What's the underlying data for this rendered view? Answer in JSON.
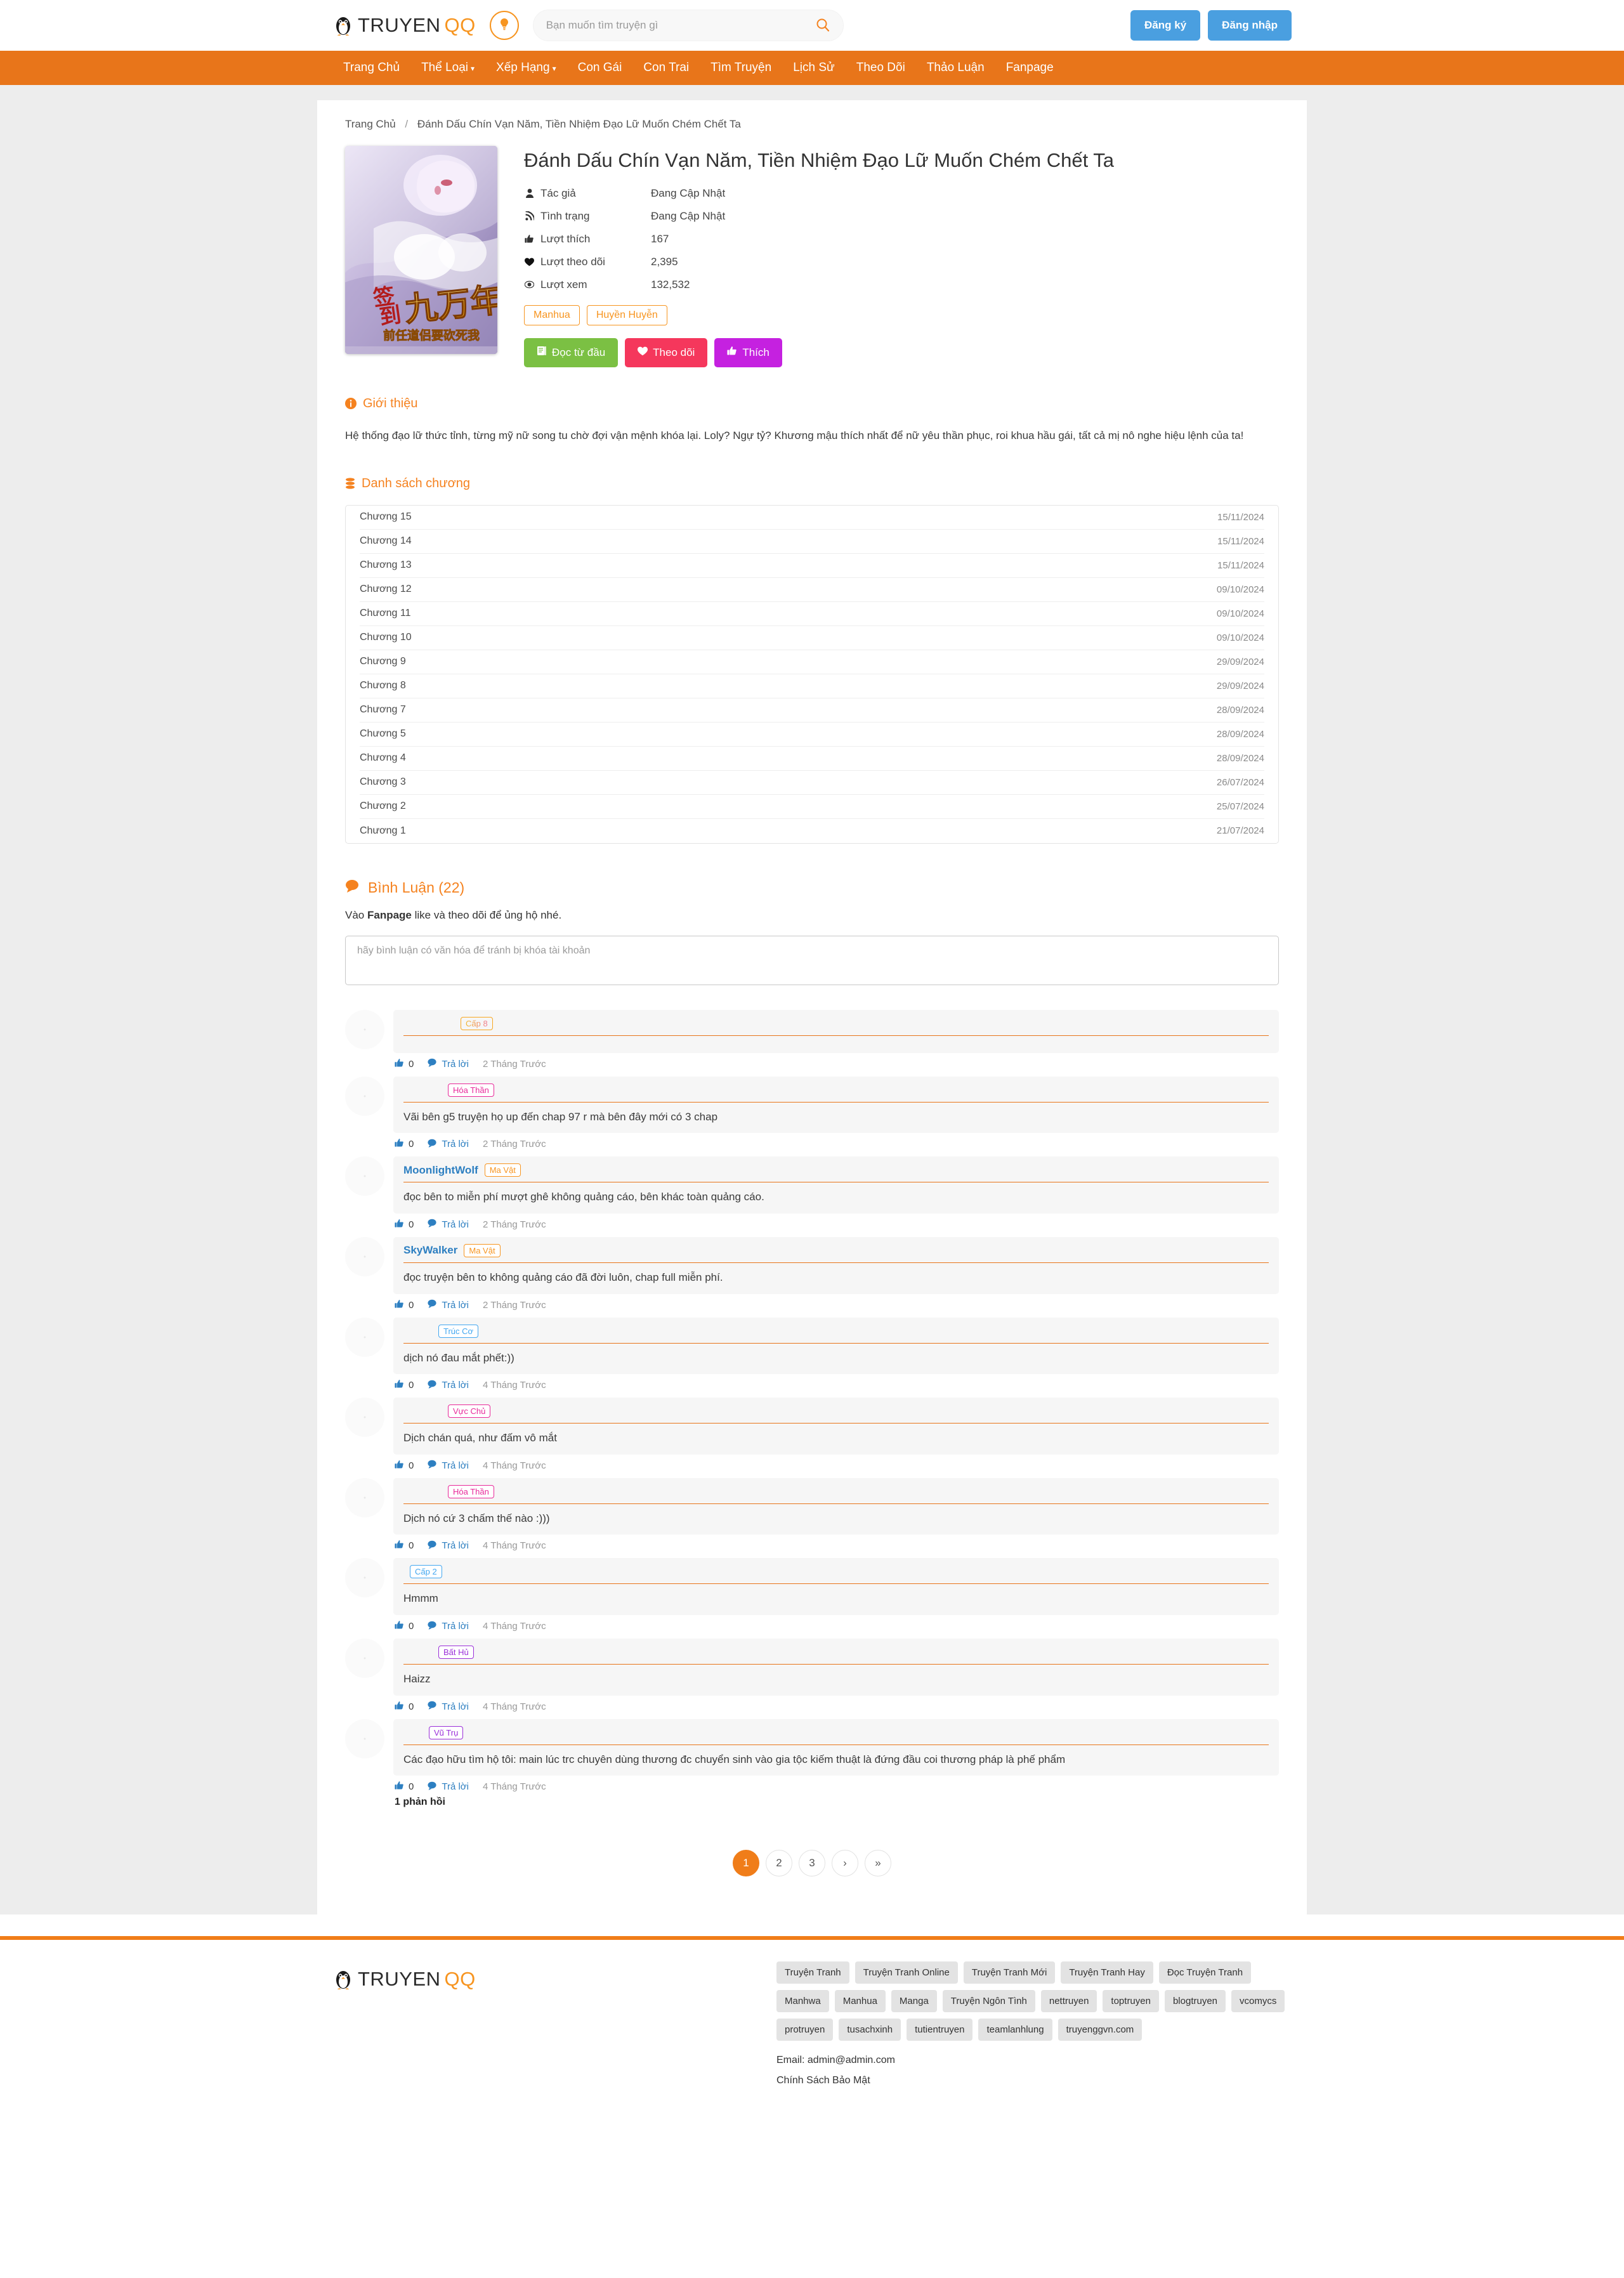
{
  "header": {
    "logo_text_1": "TRUYEN",
    "logo_text_2": "QQ",
    "bulb_icon": "lightbulb-icon",
    "search_placeholder": "Bạn muốn tìm truyện gì",
    "search_value": "",
    "search_icon": "search-icon",
    "register_label": "Đăng ký",
    "login_label": "Đăng nhập",
    "accent_color": "#f79520",
    "auth_color": "#4a9fe0"
  },
  "nav": {
    "bg_color": "#e8751a",
    "items": [
      {
        "label": "Trang Chủ",
        "caret": false
      },
      {
        "label": "Thể Loại",
        "caret": true
      },
      {
        "label": "Xếp Hạng",
        "caret": true
      },
      {
        "label": "Con Gái",
        "caret": false
      },
      {
        "label": "Con Trai",
        "caret": false
      },
      {
        "label": "Tìm Truyện",
        "caret": false
      },
      {
        "label": "Lịch Sử",
        "caret": false
      },
      {
        "label": "Theo Dõi",
        "caret": false
      },
      {
        "label": "Thảo Luận",
        "caret": false
      },
      {
        "label": "Fanpage",
        "caret": false
      }
    ]
  },
  "breadcrumb": {
    "home": "Trang Chủ",
    "separator": "/",
    "current": "Đánh Dấu Chín Vạn Năm, Tiền Nhiệm Đạo Lữ Muốn Chém Chết Ta"
  },
  "comic": {
    "title": "Đánh Dấu Chín Vạn Năm, Tiền Nhiệm Đạo Lữ Muốn Chém Chết Ta",
    "cover_alt": "comic-cover",
    "meta": [
      {
        "icon": "user-icon",
        "label": "Tác giả",
        "value": "Đang Cập Nhật"
      },
      {
        "icon": "rss-icon",
        "label": "Tình trạng",
        "value": "Đang Cập Nhật"
      },
      {
        "icon": "thumbs-up-icon",
        "label": "Lượt thích",
        "value": "167"
      },
      {
        "icon": "heart-icon",
        "label": "Lượt theo dõi",
        "value": "2,395"
      },
      {
        "icon": "eye-icon",
        "label": "Lượt xem",
        "value": "132,532"
      }
    ],
    "tags": [
      "Manhua",
      "Huyền Huyễn"
    ],
    "actions": [
      {
        "label": "Đọc từ đầu",
        "icon": "book-icon",
        "color": "#7bc043"
      },
      {
        "label": "Theo dõi",
        "icon": "heart-icon",
        "color": "#f5375c"
      },
      {
        "label": "Thích",
        "icon": "thumbs-up-icon",
        "color": "#c521e0"
      }
    ]
  },
  "intro": {
    "heading": "Giới thiệu",
    "heading_icon": "info-icon",
    "text": "Hệ thống đạo lữ thức tỉnh, từng mỹ nữ song tu chờ đợi vận mệnh khóa lại. Loly? Ngự tỷ? Khương mậu thích nhất để nữ yêu thần phục, roi khua hầu gái, tất cả mị nô nghe hiệu lệnh của ta!"
  },
  "chapter_section": {
    "heading": "Danh sách chương",
    "heading_icon": "list-icon",
    "chapters": [
      {
        "name": "Chương 15",
        "date": "15/11/2024"
      },
      {
        "name": "Chương 14",
        "date": "15/11/2024"
      },
      {
        "name": "Chương 13",
        "date": "15/11/2024"
      },
      {
        "name": "Chương 12",
        "date": "09/10/2024"
      },
      {
        "name": "Chương 11",
        "date": "09/10/2024"
      },
      {
        "name": "Chương 10",
        "date": "09/10/2024"
      },
      {
        "name": "Chương 9",
        "date": "29/09/2024"
      },
      {
        "name": "Chương 8",
        "date": "29/09/2024"
      },
      {
        "name": "Chương 7",
        "date": "28/09/2024"
      },
      {
        "name": "Chương 5",
        "date": "28/09/2024"
      },
      {
        "name": "Chương 4",
        "date": "28/09/2024"
      },
      {
        "name": "Chương 3",
        "date": "26/07/2024"
      },
      {
        "name": "Chương 2",
        "date": "25/07/2024"
      },
      {
        "name": "Chương 1",
        "date": "21/07/2024"
      }
    ]
  },
  "comments": {
    "heading": "Bình Luận (22)",
    "heading_icon": "comment-icon",
    "note_prefix": "Vào ",
    "note_bold": "Fanpage",
    "note_suffix": " like và theo dõi để ủng hộ nhé.",
    "input_placeholder": "hãy bình luận có văn hóa để tránh bị khóa tài khoản",
    "input_value": "",
    "like_label": "0",
    "reply_label": "Trả lời",
    "items": [
      {
        "user": "",
        "badge": "Cấp 8",
        "badge_style": "grad",
        "text": "",
        "likes": "0",
        "reply": "Trả lời",
        "time": "2 Tháng Trước"
      },
      {
        "user": "",
        "badge": "Hóa Thần",
        "badge_style": "pink",
        "text": "Vãi bên g5 truyện họ up đến chap 97 r mà bên đây mới có 3 chap",
        "likes": "0",
        "reply": "Trả lời",
        "time": "2 Tháng Trước"
      },
      {
        "user": "MoonlightWolf",
        "badge": "Ma Vật",
        "badge_style": "orange",
        "text": "đọc bên to miễn phí mượt ghê không quảng cáo, bên khác toàn quảng cáo.",
        "likes": "0",
        "reply": "Trả lời",
        "time": "2 Tháng Trước"
      },
      {
        "user": "SkyWalker",
        "badge": "Ma Vật",
        "badge_style": "orange",
        "text": "đọc truyện bên to không quảng cáo đã đời luôn, chap full miễn phí.",
        "likes": "0",
        "reply": "Trả lời",
        "time": "2 Tháng Trước"
      },
      {
        "user": "",
        "badge": "Trúc Cơ",
        "badge_style": "blue",
        "text": "dịch nó đau mắt phết:))",
        "likes": "0",
        "reply": "Trả lời",
        "time": "4 Tháng Trước"
      },
      {
        "user": "",
        "badge": "Vực Chủ",
        "badge_style": "pink",
        "text": "Dịch chán quá, như đấm vô mắt",
        "likes": "0",
        "reply": "Trả lời",
        "time": "4 Tháng Trước"
      },
      {
        "user": "",
        "badge": "Hóa Thần",
        "badge_style": "pink",
        "text": "Dịch nó cứ 3 chấm thế nào :)))",
        "likes": "0",
        "reply": "Trả lời",
        "time": "4 Tháng Trước"
      },
      {
        "user": "",
        "badge": "Cấp 2",
        "badge_style": "blue",
        "text": "Hmmm",
        "likes": "0",
        "reply": "Trả lời",
        "time": "4 Tháng Trước"
      },
      {
        "user": "",
        "badge": "Bất Hủ",
        "badge_style": "purple",
        "text": "Haizz",
        "likes": "0",
        "reply": "Trả lời",
        "time": "4 Tháng Trước"
      },
      {
        "user": "",
        "badge": "Vũ Trụ",
        "badge_style": "purple",
        "text": "Các đạo hữu tìm hộ tôi: main lúc trc chuyên dùng thương đc chuyển sinh vào gia tộc kiếm thuật là đứng đầu coi thương pháp là phế phẩm",
        "likes": "0",
        "reply": "Trả lời",
        "time": "4 Tháng Trước",
        "reply_count": "1 phản hồi"
      }
    ],
    "pagination": [
      {
        "label": "1",
        "active": true
      },
      {
        "label": "2",
        "active": false
      },
      {
        "label": "3",
        "active": false
      },
      {
        "label": "›",
        "active": false
      },
      {
        "label": "»",
        "active": false
      }
    ]
  },
  "footer": {
    "logo_text_1": "TRUYEN",
    "logo_text_2": "QQ",
    "keyword_rows": [
      [
        "Truyện Tranh",
        "Truyện Tranh Online",
        "Truyện Tranh Mới",
        "Truyện Tranh Hay",
        "Đọc Truyện Tranh"
      ],
      [
        "Manhwa",
        "Manhua",
        "Manga",
        "Truyện Ngôn Tình",
        "nettruyen",
        "toptruyen",
        "blogtruyen",
        "vcomycs"
      ],
      [
        "protruyen",
        "tusachxinh",
        "tutientruyen",
        "teamlanhlung",
        "truyenggvn.com"
      ]
    ],
    "email": "Email: admin@admin.com",
    "privacy": "Chính Sách Bảo Mật"
  }
}
